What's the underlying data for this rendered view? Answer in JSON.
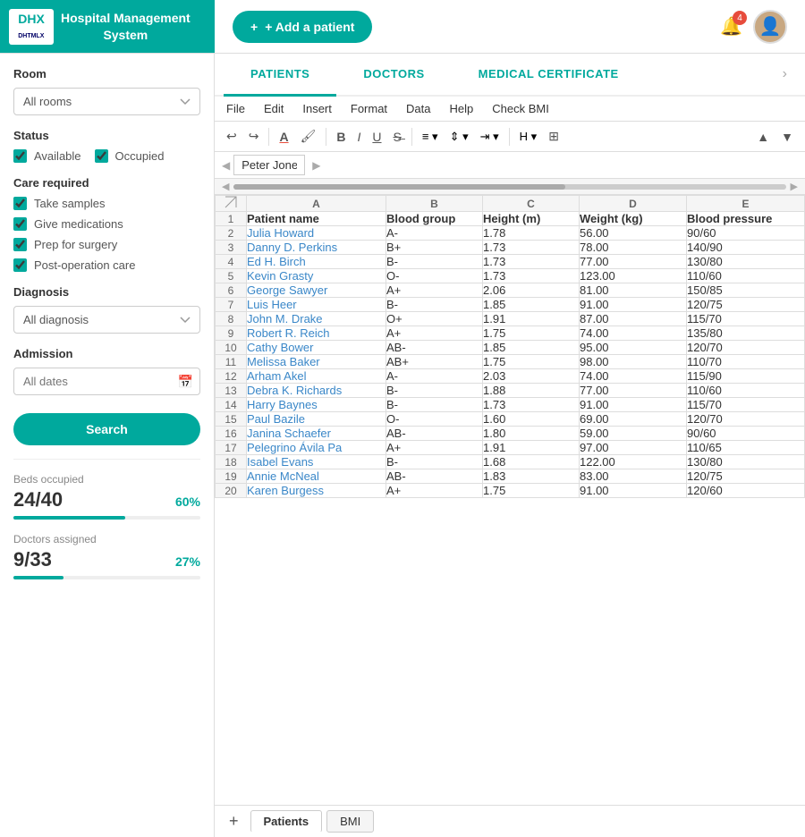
{
  "header": {
    "logo_text": "DHX",
    "logo_sub": "DHTMLX",
    "app_title": "Hospital Management\nSystem",
    "add_patient_label": "+ Add a patient",
    "notification_count": "4"
  },
  "sidebar": {
    "room_label": "Room",
    "room_placeholder": "All rooms",
    "status_label": "Status",
    "status_available": "Available",
    "status_occupied": "Occupied",
    "care_label": "Care required",
    "care_items": [
      "Take samples",
      "Give medications",
      "Prep for surgery",
      "Post-operation care"
    ],
    "diagnosis_label": "Diagnosis",
    "diagnosis_placeholder": "All diagnosis",
    "admission_label": "Admission",
    "admission_placeholder": "All dates",
    "search_btn": "Search",
    "beds_label": "Beds occupied",
    "beds_value": "24/40",
    "beds_percent": "60%",
    "beds_fill": 60,
    "doctors_label": "Doctors assigned",
    "doctors_value": "9/33",
    "doctors_percent": "27%",
    "doctors_fill": 27
  },
  "tabs": [
    {
      "label": "PATIENTS",
      "active": true
    },
    {
      "label": "DOCTORS",
      "active": false
    },
    {
      "label": "MEDICAL CERTIFICATE",
      "active": false
    }
  ],
  "menu": [
    "File",
    "Edit",
    "Insert",
    "Format",
    "Data",
    "Help",
    "Check BMI"
  ],
  "formula_bar": {
    "cell_name": "Peter Jones"
  },
  "columns": [
    {
      "letter": "A",
      "label": "Patient name"
    },
    {
      "letter": "B",
      "label": "Blood group"
    },
    {
      "letter": "C",
      "label": "Height (m)"
    },
    {
      "letter": "D",
      "label": "Weight (kg)"
    },
    {
      "letter": "E",
      "label": "Blood pressure"
    }
  ],
  "patients": [
    {
      "row": 2,
      "name": "Julia Howard",
      "blood": "A-",
      "height": "1.78",
      "weight": "56.00",
      "bp": "90/60"
    },
    {
      "row": 3,
      "name": "Danny D. Perkins",
      "blood": "B+",
      "height": "1.73",
      "weight": "78.00",
      "bp": "140/90"
    },
    {
      "row": 4,
      "name": "Ed H. Birch",
      "blood": "B-",
      "height": "1.73",
      "weight": "77.00",
      "bp": "130/80"
    },
    {
      "row": 5,
      "name": "Kevin Grasty",
      "blood": "O-",
      "height": "1.73",
      "weight": "123.00",
      "bp": "110/60"
    },
    {
      "row": 6,
      "name": "George Sawyer",
      "blood": "A+",
      "height": "2.06",
      "weight": "81.00",
      "bp": "150/85"
    },
    {
      "row": 7,
      "name": "Luis Heer",
      "blood": "B-",
      "height": "1.85",
      "weight": "91.00",
      "bp": "120/75"
    },
    {
      "row": 8,
      "name": "John M. Drake",
      "blood": "O+",
      "height": "1.91",
      "weight": "87.00",
      "bp": "115/70"
    },
    {
      "row": 9,
      "name": "Robert R. Reich",
      "blood": "A+",
      "height": "1.75",
      "weight": "74.00",
      "bp": "135/80"
    },
    {
      "row": 10,
      "name": "Cathy Bower",
      "blood": "AB-",
      "height": "1.85",
      "weight": "95.00",
      "bp": "120/70"
    },
    {
      "row": 11,
      "name": "Melissa Baker",
      "blood": "AB+",
      "height": "1.75",
      "weight": "98.00",
      "bp": "110/70"
    },
    {
      "row": 12,
      "name": "Arham Akel",
      "blood": "A-",
      "height": "2.03",
      "weight": "74.00",
      "bp": "115/90"
    },
    {
      "row": 13,
      "name": "Debra K. Richards",
      "blood": "B-",
      "height": "1.88",
      "weight": "77.00",
      "bp": "110/60"
    },
    {
      "row": 14,
      "name": "Harry Baynes",
      "blood": "B-",
      "height": "1.73",
      "weight": "91.00",
      "bp": "115/70"
    },
    {
      "row": 15,
      "name": "Paul Bazile",
      "blood": "O-",
      "height": "1.60",
      "weight": "69.00",
      "bp": "120/70"
    },
    {
      "row": 16,
      "name": "Janina Schaefer",
      "blood": "AB-",
      "height": "1.80",
      "weight": "59.00",
      "bp": "90/60"
    },
    {
      "row": 17,
      "name": "Pelegrino Ávila Pa",
      "blood": "A+",
      "height": "1.91",
      "weight": "97.00",
      "bp": "110/65"
    },
    {
      "row": 18,
      "name": "Isabel Evans",
      "blood": "B-",
      "height": "1.68",
      "weight": "122.00",
      "bp": "130/80"
    },
    {
      "row": 19,
      "name": "Annie McNeal",
      "blood": "AB-",
      "height": "1.83",
      "weight": "83.00",
      "bp": "120/75"
    },
    {
      "row": 20,
      "name": "Karen Burgess",
      "blood": "A+",
      "height": "1.75",
      "weight": "91.00",
      "bp": "120/60"
    }
  ],
  "sheet_tabs": [
    "Patients",
    "BMI"
  ]
}
